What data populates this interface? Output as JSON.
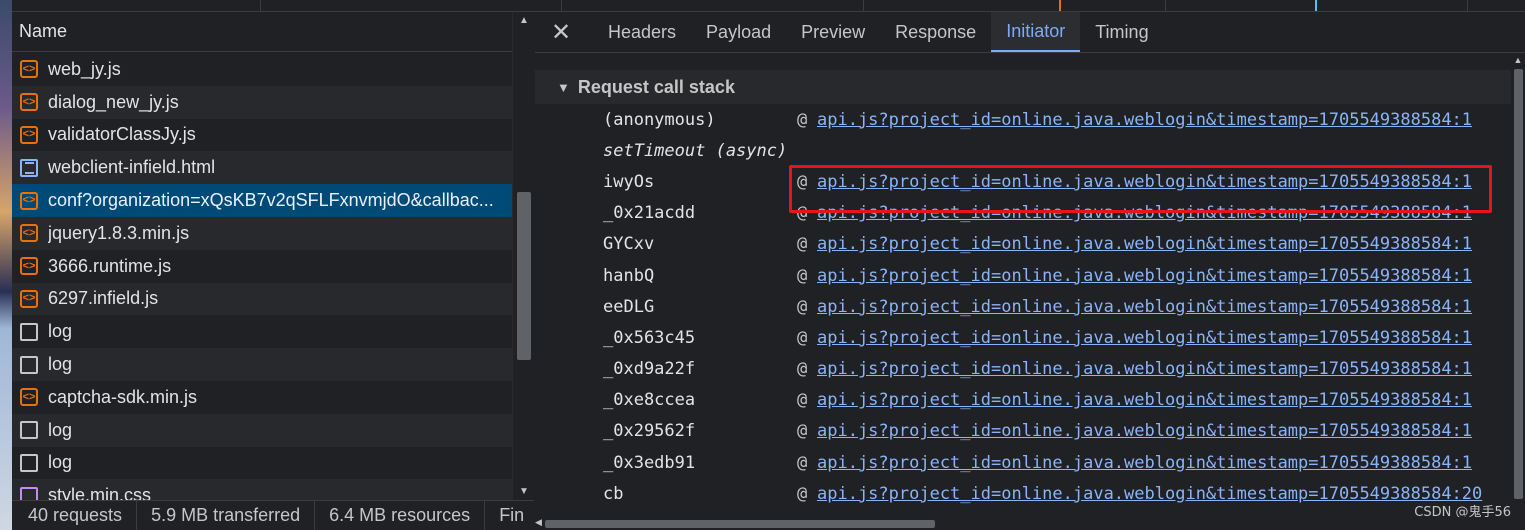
{
  "list": {
    "header": "Name",
    "items": [
      {
        "name": "web_jy.js",
        "type": "script"
      },
      {
        "name": "dialog_new_jy.js",
        "type": "script"
      },
      {
        "name": "validatorClassJy.js",
        "type": "script"
      },
      {
        "name": "webclient-infield.html",
        "type": "doc"
      },
      {
        "name": "conf?organization=xQsKB7v2qSFLFxnvmjdO&callbac...",
        "type": "script",
        "selected": true
      },
      {
        "name": "jquery1.8.3.min.js",
        "type": "script"
      },
      {
        "name": "3666.runtime.js",
        "type": "script"
      },
      {
        "name": "6297.infield.js",
        "type": "script"
      },
      {
        "name": "log",
        "type": "blank"
      },
      {
        "name": "log",
        "type": "blank"
      },
      {
        "name": "captcha-sdk.min.js",
        "type": "script"
      },
      {
        "name": "log",
        "type": "blank"
      },
      {
        "name": "log",
        "type": "blank"
      },
      {
        "name": "style.min.css",
        "type": "style"
      }
    ]
  },
  "status": {
    "requests": "40 requests",
    "transferred": "5.9 MB transferred",
    "resources": "6.4 MB resources",
    "finish": "Fin"
  },
  "tabs": [
    {
      "label": "Headers"
    },
    {
      "label": "Payload"
    },
    {
      "label": "Preview"
    },
    {
      "label": "Response"
    },
    {
      "label": "Initiator",
      "active": true
    },
    {
      "label": "Timing"
    }
  ],
  "callstack": {
    "title": "Request call stack",
    "rows": [
      {
        "fn": "(anonymous)",
        "at": "@",
        "link": "api.js?project_id=online.java.weblogin&timestamp=1705549388584:1"
      },
      {
        "fn": "setTimeout (async)",
        "at": "",
        "link": "",
        "async": true
      },
      {
        "fn": "iwyOs",
        "at": "@",
        "link": "api.js?project_id=online.java.weblogin&timestamp=1705549388584:1"
      },
      {
        "fn": "_0x21acdd",
        "at": "@",
        "link": "api.js?project_id=online.java.weblogin&timestamp=1705549388584:1"
      },
      {
        "fn": "GYCxv",
        "at": "@",
        "link": "api.js?project_id=online.java.weblogin&timestamp=1705549388584:1"
      },
      {
        "fn": "hanbQ",
        "at": "@",
        "link": "api.js?project_id=online.java.weblogin&timestamp=1705549388584:1"
      },
      {
        "fn": "eeDLG",
        "at": "@",
        "link": "api.js?project_id=online.java.weblogin&timestamp=1705549388584:1"
      },
      {
        "fn": "_0x563c45",
        "at": "@",
        "link": "api.js?project_id=online.java.weblogin&timestamp=1705549388584:1"
      },
      {
        "fn": "_0xd9a22f",
        "at": "@",
        "link": "api.js?project_id=online.java.weblogin&timestamp=1705549388584:1"
      },
      {
        "fn": "_0xe8ccea",
        "at": "@",
        "link": "api.js?project_id=online.java.weblogin&timestamp=1705549388584:1"
      },
      {
        "fn": "_0x29562f",
        "at": "@",
        "link": "api.js?project_id=online.java.weblogin&timestamp=1705549388584:1"
      },
      {
        "fn": "_0x3edb91",
        "at": "@",
        "link": "api.js?project_id=online.java.weblogin&timestamp=1705549388584:1"
      },
      {
        "fn": "cb",
        "at": "@",
        "link": "api.js?project_id=online.java.weblogin&timestamp=1705549388584:20"
      }
    ]
  },
  "watermark": "CSDN @鬼手56",
  "icons": {
    "close": "close-icon",
    "caret": "triangle-down-icon",
    "script": "script-file-icon",
    "doc": "document-icon",
    "blank": "blank-file-icon",
    "style": "stylesheet-icon"
  },
  "colors": {
    "highlight": "#e8141c",
    "link": "#8ab4f8",
    "selected_row": "#004a77",
    "active_tab": "#7cacf8"
  }
}
